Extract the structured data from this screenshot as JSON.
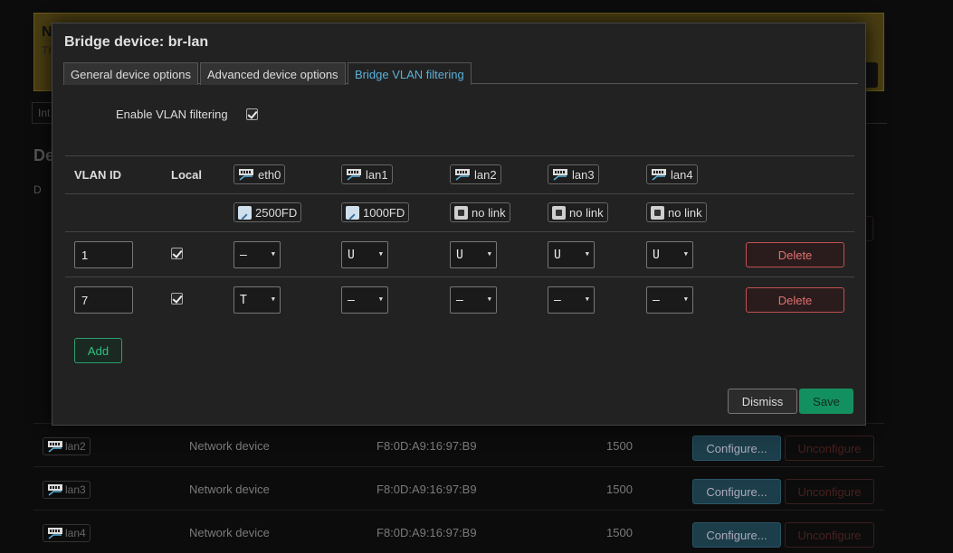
{
  "background": {
    "notice_title": "N",
    "notice_text": "Th",
    "tab_label": "Int",
    "heading": "De",
    "header_stub": "D",
    "rows": [
      {
        "device": "lan2",
        "type": "Network device",
        "mac": "F8:0D:A9:16:97:B9",
        "mtu": "1500",
        "configure": "Configure...",
        "unconfigure": "Unconfigure"
      },
      {
        "device": "lan3",
        "type": "Network device",
        "mac": "F8:0D:A9:16:97:B9",
        "mtu": "1500",
        "configure": "Configure...",
        "unconfigure": "Unconfigure"
      },
      {
        "device": "lan4",
        "type": "Network device",
        "mac": "F8:0D:A9:16:97:B9",
        "mtu": "1500",
        "configure": "Configure...",
        "unconfigure": "Unconfigure"
      }
    ]
  },
  "modal": {
    "title": "Bridge device: br-lan",
    "tabs": [
      {
        "label": "General device options",
        "active": false
      },
      {
        "label": "Advanced device options",
        "active": false
      },
      {
        "label": "Bridge VLAN filtering",
        "active": true
      }
    ],
    "enable_vlan_label": "Enable VLAN filtering",
    "enable_vlan_checked": true,
    "table": {
      "col_vlan_id": "VLAN ID",
      "col_local": "Local",
      "ports": [
        {
          "name": "eth0",
          "status": "2500FD",
          "link": true
        },
        {
          "name": "lan1",
          "status": "1000FD",
          "link": true
        },
        {
          "name": "lan2",
          "status": "no link",
          "link": false
        },
        {
          "name": "lan3",
          "status": "no link",
          "link": false
        },
        {
          "name": "lan4",
          "status": "no link",
          "link": false
        }
      ],
      "rows": [
        {
          "vlan_id": "1",
          "local": true,
          "ports": [
            "–",
            "U",
            "U",
            "U",
            "U"
          ],
          "delete_label": "Delete"
        },
        {
          "vlan_id": "7",
          "local": true,
          "ports": [
            "T",
            "–",
            "–",
            "–",
            "–"
          ],
          "delete_label": "Delete"
        }
      ]
    },
    "add_label": "Add",
    "dismiss_label": "Dismiss",
    "save_label": "Save"
  },
  "colors": {
    "accent_blue": "#5ab0d8",
    "save_green": "#139060",
    "delete_red": "#c05050",
    "add_green": "#30c080"
  }
}
